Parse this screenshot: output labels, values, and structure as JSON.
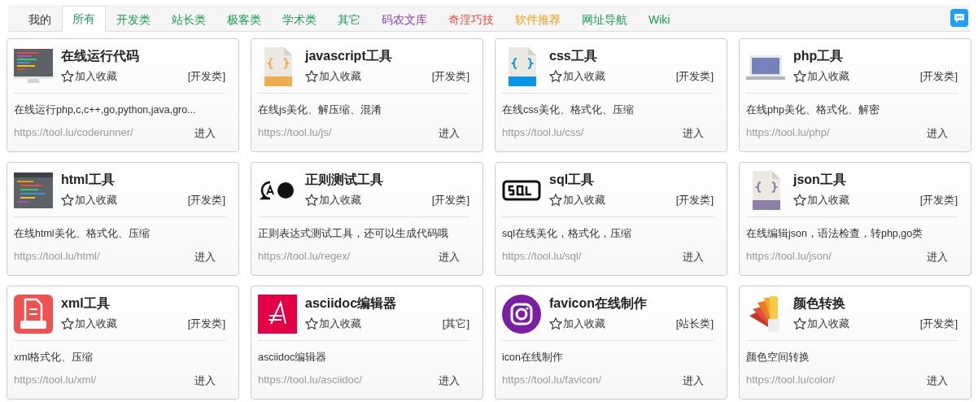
{
  "tabs": [
    {
      "label": "我的",
      "selected": false,
      "color": "#333333"
    },
    {
      "label": "所有",
      "selected": true,
      "color": "#1e9b4f"
    },
    {
      "label": "开发类",
      "selected": false,
      "color": "#1e9b4f"
    },
    {
      "label": "站长类",
      "selected": false,
      "color": "#1e9b4f"
    },
    {
      "label": "极客类",
      "selected": false,
      "color": "#1e9b4f"
    },
    {
      "label": "学术类",
      "selected": false,
      "color": "#1e9b4f"
    },
    {
      "label": "其它",
      "selected": false,
      "color": "#1e9b4f"
    },
    {
      "label": "码农文库",
      "selected": false,
      "color": "#8e44ad"
    },
    {
      "label": "奇淫巧技",
      "selected": false,
      "color": "#e74c3c"
    },
    {
      "label": "软件推荐",
      "selected": false,
      "color": "#f39c12"
    },
    {
      "label": "网址导航",
      "selected": false,
      "color": "#1e9b4f"
    },
    {
      "label": "Wiki",
      "selected": false,
      "color": "#1e9b4f"
    }
  ],
  "tools": [
    {
      "title": "在线运行代码",
      "favorite": "加入收藏",
      "category": "[开发类]",
      "description": "在线运行php,c,c++,go,python,java,gro...",
      "url": "https://tool.lu/coderunner/",
      "enter": "进入"
    },
    {
      "title": "javascript工具",
      "favorite": "加入收藏",
      "category": "[开发类]",
      "description": "在线js美化、解压缩、混淆",
      "url": "https://tool.lu/js/",
      "enter": "进入"
    },
    {
      "title": "css工具",
      "favorite": "加入收藏",
      "category": "[开发类]",
      "description": "在线css美化、格式化、压缩",
      "url": "https://tool.lu/css/",
      "enter": "进入"
    },
    {
      "title": "php工具",
      "favorite": "加入收藏",
      "category": "[开发类]",
      "description": "在线php美化、格式化、解密",
      "url": "https://tool.lu/php/",
      "enter": "进入"
    },
    {
      "title": "html工具",
      "favorite": "加入收藏",
      "category": "[开发类]",
      "description": "在线html美化、格式化、压缩",
      "url": "https://tool.lu/html/",
      "enter": "进入"
    },
    {
      "title": "正则测试工具",
      "favorite": "加入收藏",
      "category": "[开发类]",
      "description": "正则表达式测试工具，还可以生成代码哦",
      "url": "https://tool.lu/regex/",
      "enter": "进入"
    },
    {
      "title": "sql工具",
      "favorite": "加入收藏",
      "category": "[开发类]",
      "description": "sql在线美化，格式化，压缩",
      "url": "https://tool.lu/sql/",
      "enter": "进入"
    },
    {
      "title": "json工具",
      "favorite": "加入收藏",
      "category": "[开发类]",
      "description": "在线编辑json，语法检查，转php,go类",
      "url": "https://tool.lu/json/",
      "enter": "进入"
    },
    {
      "title": "xml工具",
      "favorite": "加入收藏",
      "category": "[开发类]",
      "description": "xml格式化、压缩",
      "url": "https://tool.lu/xml/",
      "enter": "进入"
    },
    {
      "title": "asciidoc编辑器",
      "favorite": "加入收藏",
      "category": "[其它]",
      "description": "asciidoc编辑器",
      "url": "https://tool.lu/asciidoc/",
      "enter": "进入"
    },
    {
      "title": "favicon在线制作",
      "favorite": "加入收藏",
      "category": "[站长类]",
      "description": "icon在线制作",
      "url": "https://tool.lu/favicon/",
      "enter": "进入"
    },
    {
      "title": "颜色转换",
      "favorite": "加入收藏",
      "category": "[开发类]",
      "description": "颜色空间转换",
      "url": "https://tool.lu/color/",
      "enter": "进入"
    }
  ]
}
